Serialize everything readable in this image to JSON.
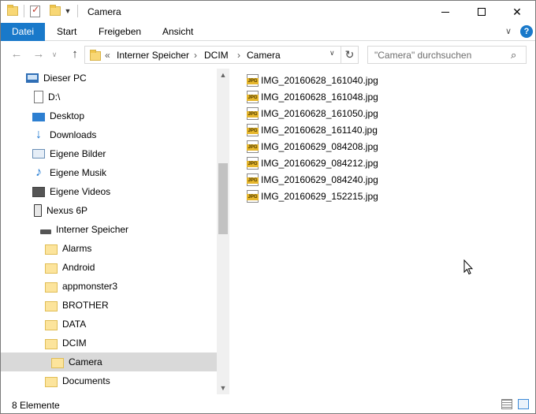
{
  "window": {
    "title": "Camera"
  },
  "ribbon": {
    "tabs": [
      "Datei",
      "Start",
      "Freigeben",
      "Ansicht"
    ],
    "help_label": "?"
  },
  "address": {
    "more": "«",
    "crumbs": [
      "Interner Speicher",
      "DCIM",
      "Camera"
    ],
    "separator": "›"
  },
  "search": {
    "placeholder": "\"Camera\" durchsuchen"
  },
  "nav_tree": {
    "items": [
      {
        "label": "Dieser PC",
        "icon": "pc-icon"
      },
      {
        "label": "D:\\",
        "icon": "drive-icon"
      },
      {
        "label": "Desktop",
        "icon": "desktop-icon"
      },
      {
        "label": "Downloads",
        "icon": "download-icon"
      },
      {
        "label": "Eigene Bilder",
        "icon": "pictures-icon"
      },
      {
        "label": "Eigene Musik",
        "icon": "music-icon"
      },
      {
        "label": "Eigene Videos",
        "icon": "video-icon"
      },
      {
        "label": "Nexus 6P",
        "icon": "phone-icon"
      },
      {
        "label": "Interner Speicher",
        "icon": "storage-icon"
      },
      {
        "label": "Alarms",
        "icon": "folder-icon"
      },
      {
        "label": "Android",
        "icon": "folder-icon"
      },
      {
        "label": "appmonster3",
        "icon": "folder-icon"
      },
      {
        "label": "BROTHER",
        "icon": "folder-icon"
      },
      {
        "label": "DATA",
        "icon": "folder-icon"
      },
      {
        "label": "DCIM",
        "icon": "folder-icon"
      },
      {
        "label": "Camera",
        "icon": "folder-icon",
        "selected": true
      },
      {
        "label": "Documents",
        "icon": "folder-icon"
      }
    ]
  },
  "files": [
    "IMG_20160628_161040.jpg",
    "IMG_20160628_161048.jpg",
    "IMG_20160628_161050.jpg",
    "IMG_20160628_161140.jpg",
    "IMG_20160629_084208.jpg",
    "IMG_20160629_084212.jpg",
    "IMG_20160629_084240.jpg",
    "IMG_20160629_152215.jpg"
  ],
  "file_icon_text": "JPG",
  "status": {
    "count_text": "8 Elemente"
  },
  "colors": {
    "accent": "#1979ca",
    "selection": "#d9d9d9",
    "folder": "#fce49c"
  }
}
